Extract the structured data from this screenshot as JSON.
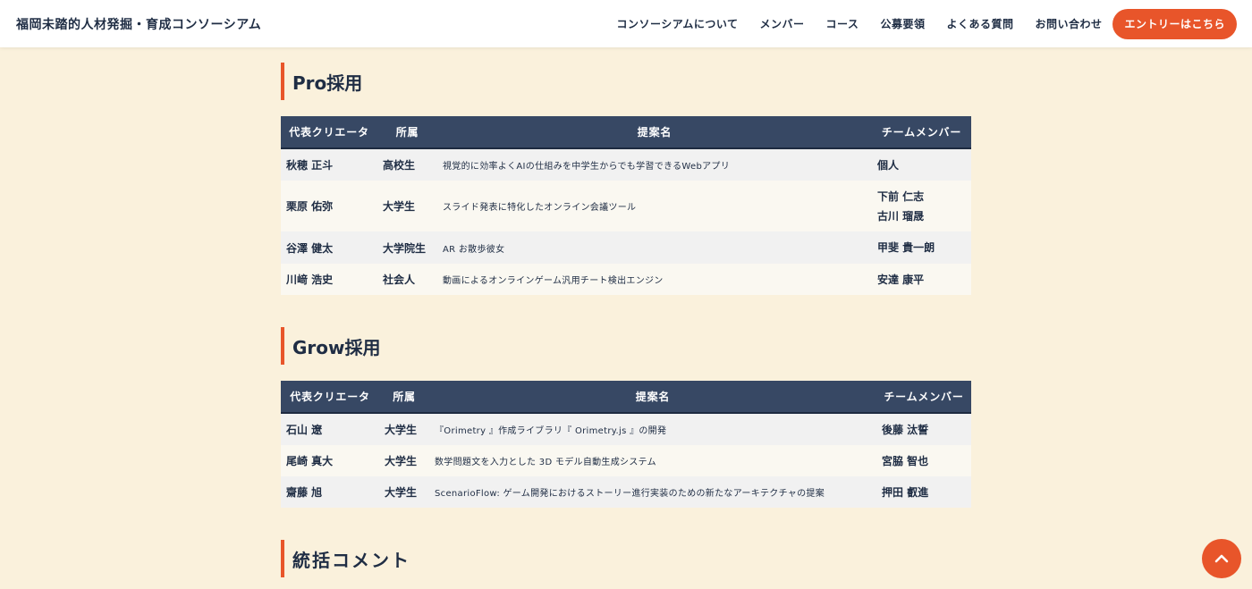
{
  "header": {
    "site_title": "福岡未踏的人材発掘・育成コンソーシアム",
    "nav": [
      {
        "label": "コンソーシアムについて"
      },
      {
        "label": "メンバー"
      },
      {
        "label": "コース"
      },
      {
        "label": "公募要領"
      },
      {
        "label": "よくある質問"
      },
      {
        "label": "お問い合わせ"
      }
    ],
    "entry_label": "エントリーはこちら"
  },
  "columns": [
    "代表クリエータ",
    "所属",
    "提案名",
    "チームメンバー"
  ],
  "sections": {
    "pro": {
      "title": "Pro採用",
      "rows": [
        {
          "creator": "秋穂 正斗",
          "affiliation": "高校生",
          "proposal": "視覚的に効率よくAIの仕組みを中学生からでも学習できるWebアプリ",
          "members": [
            "個人"
          ]
        },
        {
          "creator": "栗原 佑弥",
          "affiliation": "大学生",
          "proposal": "スライド発表に特化したオンライン会議ツール",
          "members": [
            "下前 仁志",
            "古川 瑠晟"
          ]
        },
        {
          "creator": "谷澤 健太",
          "affiliation": "大学院生",
          "proposal": "AR お散歩彼女",
          "members": [
            "甲斐 貴一朗"
          ]
        },
        {
          "creator": "川﨑 浩史",
          "affiliation": "社会人",
          "proposal": "動画によるオンラインゲーム汎用チート検出エンジン",
          "members": [
            "安達 康平"
          ]
        }
      ]
    },
    "grow": {
      "title": "Grow採用",
      "rows": [
        {
          "creator": "石山 遼",
          "affiliation": "大学生",
          "proposal": "『Orimetry 』作成ライブラリ『 Orimetry.js 』の開発",
          "members": [
            "後藤 汰誓"
          ]
        },
        {
          "creator": "尾崎 真大",
          "affiliation": "大学生",
          "proposal": "数学問題文を入力とした 3D モデル自動生成システム",
          "members": [
            "宮脇 智也"
          ]
        },
        {
          "creator": "齋藤 旭",
          "affiliation": "大学生",
          "proposal": "ScenarioFlow: ゲーム開発におけるストーリー進行実装のための新たなアーキテクチャの提案",
          "members": [
            "押田 叡進"
          ]
        }
      ]
    },
    "summary": {
      "title": "統括コメント"
    }
  },
  "colors": {
    "accent": "#e8552a",
    "header_row": "#374864",
    "background": "#faf1dc",
    "text": "#1f2d44"
  },
  "icons": {
    "page_top": "chevron-up-icon"
  }
}
